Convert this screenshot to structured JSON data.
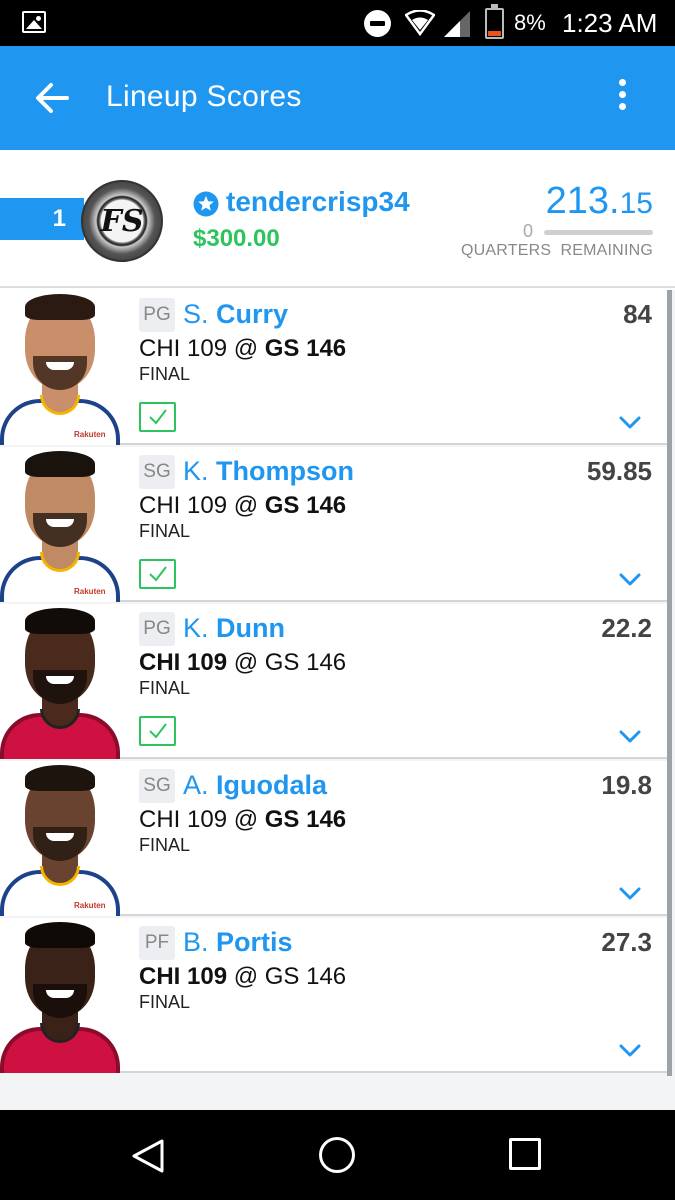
{
  "status_bar": {
    "battery_percent": "8%",
    "time": "1:23 AM",
    "icons": [
      "gallery-icon",
      "do-not-disturb-icon",
      "wifi-icon",
      "signal-icon",
      "battery-icon"
    ]
  },
  "app_bar": {
    "title": "Lineup Scores",
    "back_icon": "arrow-left-icon",
    "menu_icon": "more-vertical-icon"
  },
  "entry": {
    "rank": "1",
    "avatar_text": "FS",
    "username": "tendercrisp34",
    "winnings": "$300.00",
    "total_score_int": "213.",
    "total_score_dec": "15",
    "quarters_remaining_count": "0",
    "quarters_remaining_label": "QUARTERS  REMAINING",
    "quarters_remaining_progress": 0
  },
  "players": [
    {
      "position": "PG",
      "initial": "S.",
      "last": "Curry",
      "game_away": "CHI 109",
      "game_at": "@",
      "game_home": "GS 146",
      "bold_team": "home",
      "status": "FINAL",
      "points": "84",
      "checked": true,
      "team": "GS"
    },
    {
      "position": "SG",
      "initial": "K.",
      "last": "Thompson",
      "game_away": "CHI 109",
      "game_at": "@",
      "game_home": "GS 146",
      "bold_team": "home",
      "status": "FINAL",
      "points": "59.85",
      "checked": true,
      "team": "GS"
    },
    {
      "position": "PG",
      "initial": "K.",
      "last": "Dunn",
      "game_away": "CHI 109",
      "game_at": "@",
      "game_home": "GS 146",
      "bold_team": "away",
      "status": "FINAL",
      "points": "22.2",
      "checked": true,
      "team": "CHI"
    },
    {
      "position": "SG",
      "initial": "A.",
      "last": "Iguodala",
      "game_away": "CHI 109",
      "game_at": "@",
      "game_home": "GS 146",
      "bold_team": "home",
      "status": "FINAL",
      "points": "19.8",
      "checked": false,
      "team": "GS"
    },
    {
      "position": "PF",
      "initial": "B.",
      "last": "Portis",
      "game_away": "CHI 109",
      "game_at": "@",
      "game_home": "GS 146",
      "bold_team": "away",
      "status": "FINAL",
      "points": "27.3",
      "checked": false,
      "team": "CHI"
    }
  ],
  "jersey_brand": "Rakuten",
  "colors": {
    "accent": "#1f96f0",
    "money_green": "#2ec45d",
    "gs_jersey": "#ffffff",
    "gs_trim": "#1d428a",
    "chi_jersey": "#ce1141"
  },
  "nav_bar": {
    "icons": [
      "nav-back-icon",
      "nav-home-icon",
      "nav-recents-icon"
    ]
  }
}
